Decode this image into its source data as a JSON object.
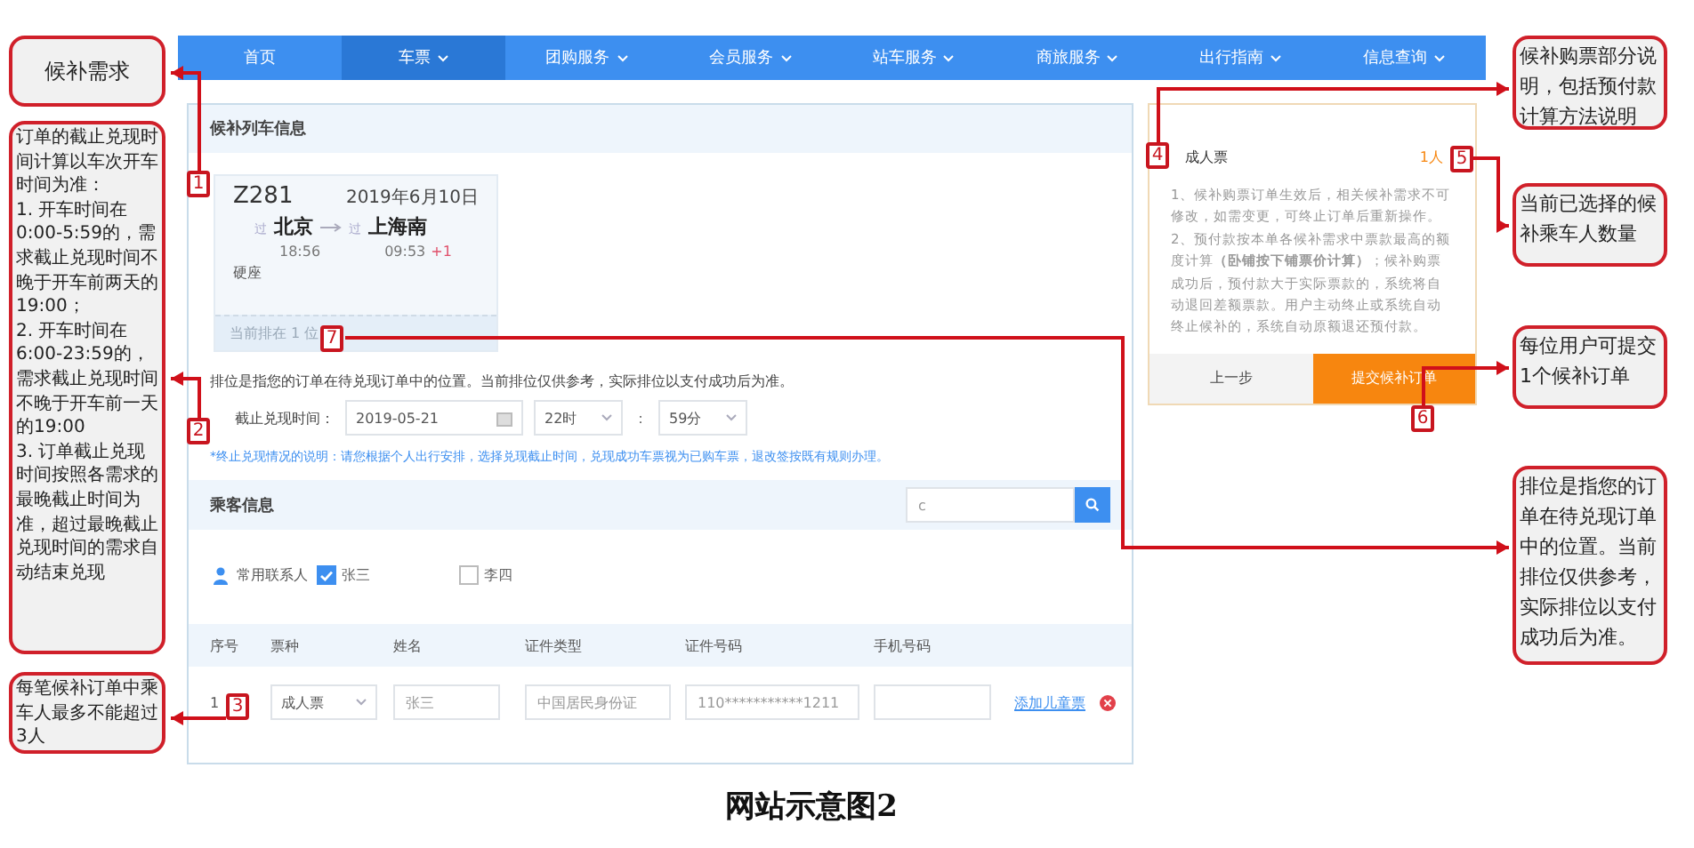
{
  "nav": [
    {
      "label": "首页",
      "dropdown": false,
      "selected": false
    },
    {
      "label": "车票",
      "dropdown": true,
      "selected": true
    },
    {
      "label": "团购服务",
      "dropdown": true,
      "selected": false
    },
    {
      "label": "会员服务",
      "dropdown": true,
      "selected": false
    },
    {
      "label": "站车服务",
      "dropdown": true,
      "selected": false
    },
    {
      "label": "商旅服务",
      "dropdown": true,
      "selected": false
    },
    {
      "label": "出行指南",
      "dropdown": true,
      "selected": false
    },
    {
      "label": "信息查询",
      "dropdown": true,
      "selected": false
    }
  ],
  "order_panel": {
    "title": "候补列车信息",
    "train": {
      "number": "Z281",
      "date": "2019年6月10日",
      "from_tag": "过",
      "from": "北京",
      "to_tag": "过",
      "to": "上海南",
      "depart": "18:56",
      "arrive": "09:53",
      "day_offset": "+1",
      "seat": "硬座",
      "queue": "当前排在 1 位"
    },
    "queue_note": "排位是指您的订单在待兑现订单中的位置。当前排位仅供参考，实际排位以支付成功后为准。",
    "deadline": {
      "label": "截止兑现时间：",
      "date": "2019-05-21",
      "hour": "22时",
      "separator": "：",
      "minute": "59分"
    },
    "deadline_note": "*终止兑现情况的说明：请您根据个人出行安排，选择兑现截止时间，兑现成功车票视为已购车票，退改签按既有规则办理。",
    "passengers": {
      "title": "乘客信息",
      "search_value": "c",
      "contacts_label": "常用联系人",
      "contacts": [
        {
          "name": "张三",
          "checked": true
        },
        {
          "name": "李四",
          "checked": false
        }
      ],
      "columns": [
        "序号",
        "票种",
        "姓名",
        "证件类型",
        "证件号码",
        "手机号码"
      ],
      "rows": [
        {
          "index": "1",
          "ticket_type": "成人票",
          "name": "张三",
          "id_type": "中国居民身份证",
          "id_number": "110***********1211",
          "action": "添加儿童票"
        }
      ]
    }
  },
  "summary": {
    "ticket_type": "成人票",
    "count": "1人",
    "notes": [
      "1、候补购票订单生效后，相关候补需求不可修改，如需变更，可终止订单后重新操作。",
      "2、预付款按本单各候补需求中票款最高的额度计算**（卧铺按下铺票价计算）**；候补购票成功后，预付款大于实际票款的，系统将自动退回差额票款。用户主动终止或系统自动终止候补的，系统自动原额退还预付款。"
    ],
    "buttons": [
      {
        "label": "上一步",
        "kind": "secondary"
      },
      {
        "label": "提交候补订单",
        "kind": "primary"
      }
    ]
  },
  "callouts_left": [
    "候补需求",
    "订单的截止兑现时间计算以车次开车时间为准：\n1. 开车时间在0:00-5:59的，需求截止兑现时间不晚于开车前两天的19:00；\n2. 开车时间在6:00-23:59的，需求截止兑现时间不晚于开车前一天的19:00\n3. 订单截止兑现时间按照各需求的最晚截止时间为准，超过最晚截止兑现时间的需求自动结束兑现",
    "每笔候补订单中乘车人最多不能超过3人"
  ],
  "callouts_right": [
    "候补购票部分说明，包括预付款计算方法说明",
    "当前已选择的候补乘车人数量",
    "每位用户可提交1个候补订单",
    "排位是指您的订单在待兑现订单中的位置。当前排位仅供参考，实际排位以支付成功后为准。"
  ],
  "markers": [
    "1",
    "2",
    "3",
    "4",
    "5",
    "6",
    "7"
  ],
  "caption": "网站示意图2"
}
